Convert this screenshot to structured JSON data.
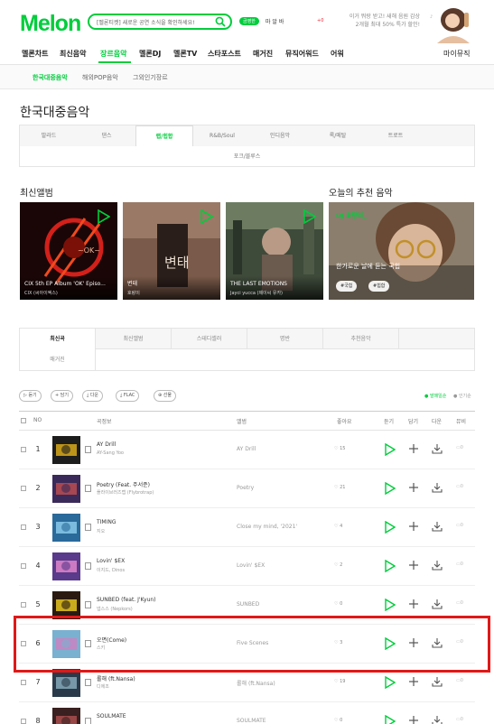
{
  "header": {
    "logo": "Melon",
    "search_text": "[멜론티켓] 새로운 공연 소식을 확인하세요!",
    "login_badge": "금영한",
    "user_text": "마 알 바",
    "ad_mark": "+0",
    "ad_line1": "이거 뭐랑 받고! 새해 음원 감상",
    "ad_line2": "2개월 최대 50% 특가 할인!"
  },
  "nav": {
    "items": [
      "멜론차트",
      "최신음악",
      "장르음악",
      "멜론DJ",
      "멜론TV",
      "스타포스트",
      "매거진",
      "뮤직어워드",
      "어워"
    ],
    "my_music": "마이뮤직"
  },
  "subnav": [
    "한국대중음악",
    "해외POP음악",
    "그외인기장르"
  ],
  "page_title": "한국대중음악",
  "genres": {
    "row1": [
      "발라드",
      "댄스",
      "랩/힙합",
      "R&B/Soul",
      "인디음악",
      "록/메탈",
      "트로트"
    ],
    "row2": [
      "포크/블루스"
    ]
  },
  "latest_albums_title": "최신앨범",
  "albums": [
    {
      "title": "CIX 5th EP Album 'OK' Episo...",
      "artist": "CIX (씨아이엑스)",
      "art_text": "~OK~"
    },
    {
      "title": "변태",
      "artist": "호랑이",
      "art_text": "변태"
    },
    {
      "title": "THE LAST EMOTIONS",
      "artist": "Jayci yucca (제이씨 유카)",
      "art_text": ""
    }
  ],
  "recommend": {
    "title": "오늘의 추천 음악",
    "tag": "DJ 호랑이_",
    "text": "한가로운 날에 듣는 국힙",
    "chips": [
      "#국힙",
      "#힙합"
    ]
  },
  "tabs": {
    "row1": [
      "최신곡",
      "최신앨범",
      "스테디셀러",
      "명반",
      "추천음악"
    ],
    "row2": [
      "매거진"
    ]
  },
  "buttons": [
    "듣기",
    "담기",
    "다운",
    "FLAC",
    "선물"
  ],
  "sort": {
    "active": "발매일순",
    "other": "인기순"
  },
  "table_headers": {
    "no": "NO",
    "song": "곡정보",
    "album": "앨범",
    "like": "좋아요",
    "play": "듣기",
    "add": "담기",
    "download": "다운",
    "mv": "뮤비"
  },
  "songs": [
    {
      "rank": "1",
      "title": "AY Drill",
      "artist": "AY-Sang Yoo",
      "album": "AY Drill",
      "likes": "15"
    },
    {
      "rank": "2",
      "title": "Poetry (Feat. 주서준)",
      "artist": "플라이브러즈랩 (Flybrotrap)",
      "album": "Poetry",
      "likes": "21"
    },
    {
      "rank": "3",
      "title": "TIMING",
      "artist": "지오",
      "album": "Close my mind, '2021'",
      "likes": "4"
    },
    {
      "rank": "4",
      "title": "Lovin' $EX",
      "artist": "이지드, Dinos",
      "album": "Lovin' $EX",
      "likes": "2"
    },
    {
      "rank": "5",
      "title": "SUNBED (feat. J'Kyun)",
      "artist": "넵스스 (Nepkors)",
      "album": "SUNBED",
      "likes": "0"
    },
    {
      "rank": "6",
      "title": "오면(Come)",
      "artist": "스키",
      "album": "Five Scenes",
      "likes": "3"
    },
    {
      "rank": "7",
      "title": "롤해 (ft.Nansa)",
      "artist": "디에조",
      "album": "롤해 (ft.Nansa)",
      "likes": "19"
    },
    {
      "rank": "8",
      "title": "SOULMATE",
      "artist": "",
      "album": "SOULMATE",
      "likes": "0"
    }
  ],
  "colors": {
    "brand": "#00cd3c",
    "highlight": "#e01818"
  }
}
